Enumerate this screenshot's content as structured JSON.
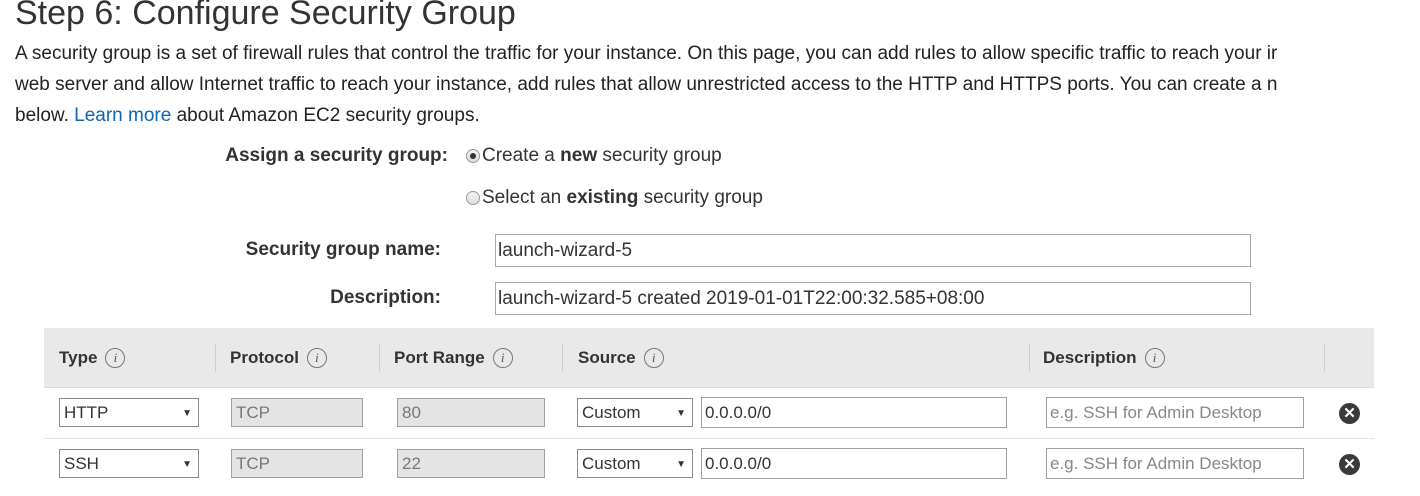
{
  "page": {
    "title": "Step 6: Configure Security Group",
    "intro_line1": "A security group is a set of firewall rules that control the traffic for your instance. On this page, you can add rules to allow specific traffic to reach your ir",
    "intro_line2": "web server and allow Internet traffic to reach your instance, add rules that allow unrestricted access to the HTTP and HTTPS ports. You can create a n",
    "intro_line3_before": "below.",
    "learn_more": "Learn more",
    "intro_line3_after": "about Amazon EC2 security groups."
  },
  "assign": {
    "label": "Assign a security group:",
    "option_new": {
      "prefix": "Create a ",
      "bold": "new",
      "suffix": " security group",
      "checked": true
    },
    "option_existing": {
      "prefix": "Select an ",
      "bold": "existing",
      "suffix": " security group",
      "checked": false
    }
  },
  "form": {
    "name_label": "Security group name:",
    "name_value": "launch-wizard-5",
    "description_label": "Description:",
    "description_value": "launch-wizard-5 created 2019-01-01T22:00:32.585+08:00"
  },
  "rules_table": {
    "headers": {
      "type": "Type",
      "protocol": "Protocol",
      "port_range": "Port Range",
      "source": "Source",
      "description": "Description"
    },
    "info_icon_glyph": "i",
    "remove_glyph": "✕",
    "rows": [
      {
        "type": "HTTP",
        "protocol": "TCP",
        "port_range": "80",
        "source_type": "Custom",
        "source_value": "0.0.0.0/0",
        "description_placeholder": "e.g. SSH for Admin Desktop"
      },
      {
        "type": "SSH",
        "protocol": "TCP",
        "port_range": "22",
        "source_type": "Custom",
        "source_value": "0.0.0.0/0",
        "description_placeholder": "e.g. SSH for Admin Desktop"
      }
    ]
  }
}
